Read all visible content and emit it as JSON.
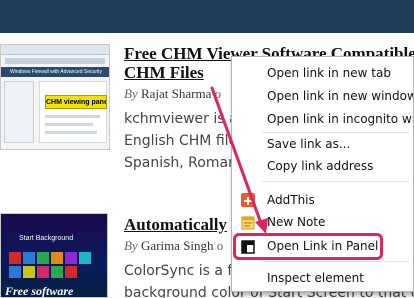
{
  "posts": [
    {
      "title_line1": "Free CHM Viewer Software Compatible",
      "title_line2": "CHM Files",
      "by": "By",
      "author": "Rajat Sharma",
      "author_tail": "o",
      "excerpt": [
        "kchmviewer is a",
        "English CHM file",
        "Spanish, Romani"
      ],
      "thumb": {
        "banner": "Windows Firewall with Advanced Security",
        "label": "CHM viewing panel"
      }
    },
    {
      "title_line1": "Automatically",
      "by": "By",
      "author": "Garima Singh",
      "author_tail": "o",
      "excerpt": [
        "ColorSync is a f",
        "background color of Start Screen to that of"
      ],
      "thumb": {
        "label": "Start Background",
        "bottom_text": "Free software"
      }
    }
  ],
  "context_menu": {
    "items": [
      {
        "label": "Open link in new tab"
      },
      {
        "label": "Open link in new window"
      },
      {
        "label": "Open link in incognito wind"
      },
      {
        "label": "Save link as..."
      },
      {
        "label": "Copy link address"
      },
      {
        "label": "AddThis",
        "icon": "addthis-icon"
      },
      {
        "label": "New Note",
        "icon": "note-icon"
      },
      {
        "label": "Open Link in Panel",
        "icon": "panel-icon",
        "highlighted": true
      },
      {
        "label": "Inspect element"
      }
    ]
  },
  "colors": {
    "topbar": "#1f3c59",
    "highlight": "#e0245e",
    "addthis": "#f05a28"
  }
}
